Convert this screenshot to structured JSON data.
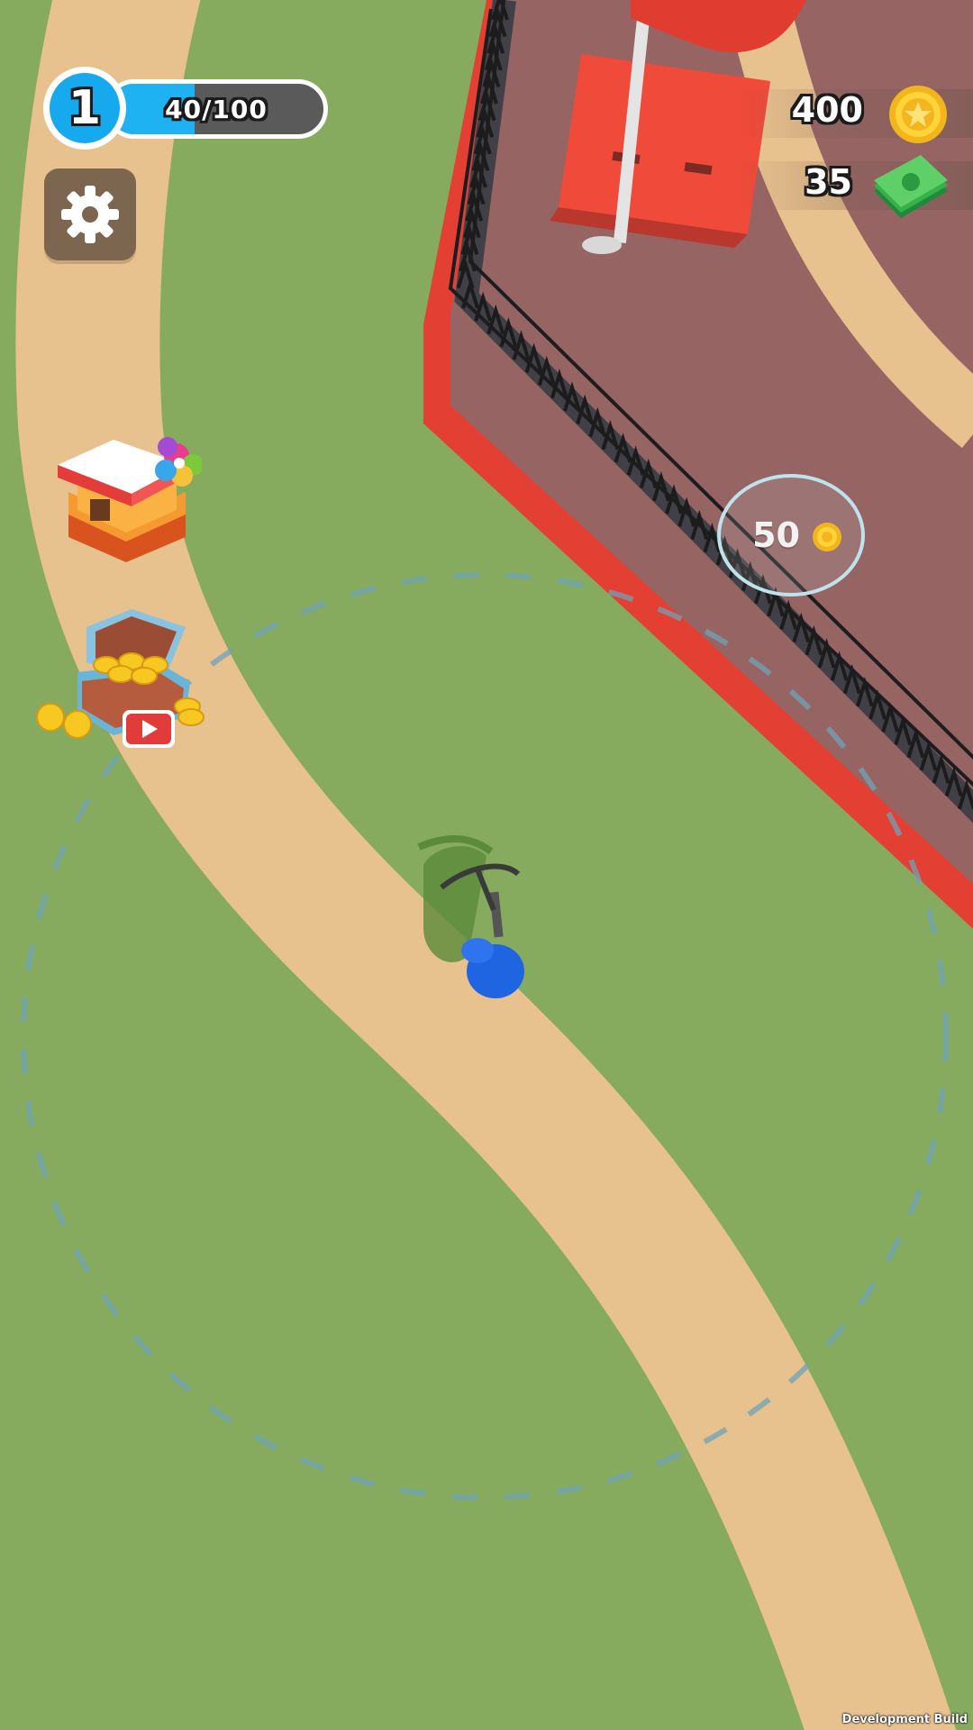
{
  "hud": {
    "level": "1",
    "xp_text": "40/100",
    "xp_progress": 0.4
  },
  "currency": {
    "coins": "400",
    "cash": "35"
  },
  "unlock_pad": {
    "price": "50"
  },
  "footer": {
    "build_label": "Development Build"
  },
  "icons": {
    "settings": "gear-icon",
    "shop": "shop-icon",
    "chest": "treasure-chest-icon",
    "video": "play-video-icon",
    "coin": "coin-icon",
    "cash": "cash-icon"
  },
  "colors": {
    "grass": "#86ab5e",
    "path": "#e7c18e",
    "arena_floor": "#976464",
    "arena_border": "#e33f33",
    "player": "#1f64e0",
    "xp_fill": "#1eb2f2"
  }
}
